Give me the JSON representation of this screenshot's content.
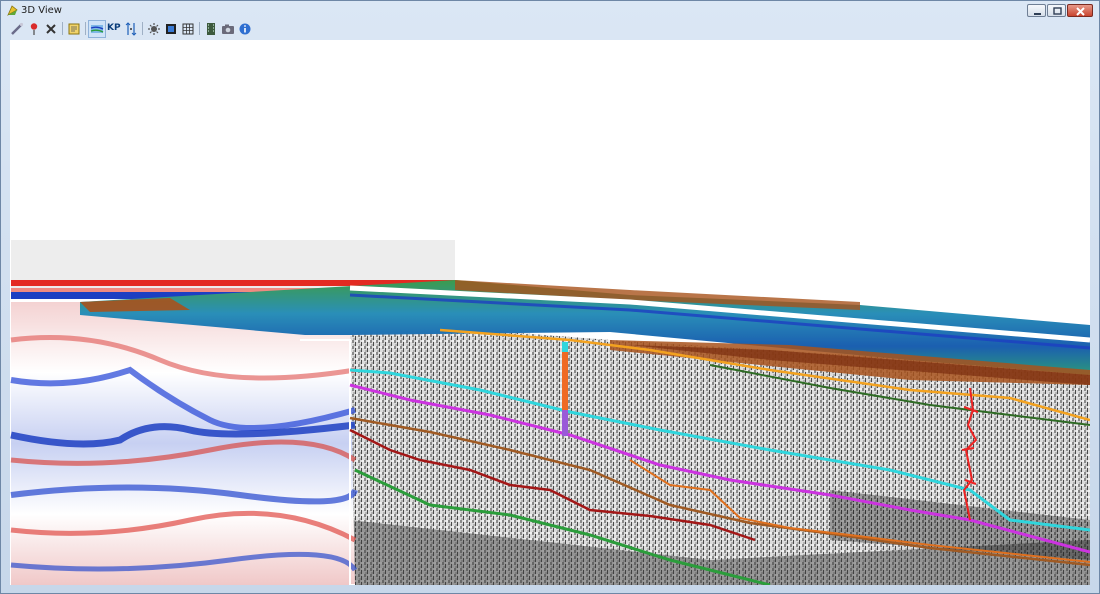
{
  "window": {
    "title": "3D View",
    "controls": [
      "minimize-icon",
      "restore-icon",
      "close-icon"
    ]
  },
  "toolbar": {
    "kp_label": "KP",
    "buttons": [
      {
        "name": "ruler-tool",
        "icon": "ruler-icon"
      },
      {
        "name": "pick-point-tool",
        "icon": "map-pin-icon"
      },
      {
        "name": "delete-tool",
        "icon": "x-icon"
      },
      {
        "name": "layer-settings-tool",
        "icon": "layers-icon"
      },
      {
        "name": "horizon-tool",
        "icon": "horizon-icon"
      },
      {
        "name": "kp-tool",
        "icon": "kp-icon"
      },
      {
        "name": "vertical-scale-tool",
        "icon": "vertical-arrows-icon"
      },
      {
        "name": "light-settings-tool",
        "icon": "sun-icon"
      },
      {
        "name": "color-scale-tool",
        "icon": "palette-icon"
      },
      {
        "name": "grid-tool",
        "icon": "grid-icon"
      },
      {
        "name": "export-tool",
        "icon": "film-icon"
      },
      {
        "name": "snapshot-tool",
        "icon": "camera-icon"
      },
      {
        "name": "info-tool",
        "icon": "info-icon"
      }
    ]
  },
  "colors": {
    "window_frame": "#6e87a6",
    "titlebar": "#dbe7f5",
    "viewport_bg": "#ffffff",
    "seismic_positive": "#d62a22",
    "seismic_negative": "#1d3fc2",
    "bathymetry_deep": "#1b5fb0",
    "bathymetry_mid": "#37b36b",
    "bathymetry_shallow": "#a8521c",
    "horizon_orange": "#f3a21f",
    "horizon_cyan": "#2fd6dd",
    "horizon_magenta": "#cc33e0",
    "horizon_brown": "#a05a23",
    "horizon_red": "#a31717",
    "horizon_green": "#2b9d3b",
    "horizon_darkgreen": "#2e6b24",
    "well_log": "#ee2222"
  }
}
